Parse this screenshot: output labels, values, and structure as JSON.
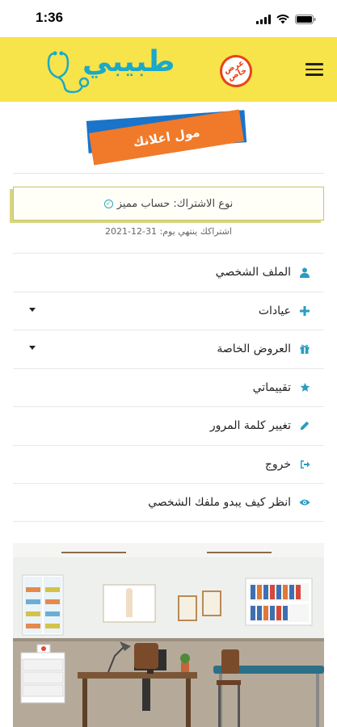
{
  "status_bar": {
    "time": "1:36"
  },
  "header": {
    "logo_text": "طبيبي",
    "offer_badge": "عرض خاص"
  },
  "ad_banner": {
    "label": "مول اعلانك"
  },
  "subscription": {
    "type_label": "نوع الاشتراك: حساب مميز",
    "expiry_text": "اشتراكك ينتهي يوم: 31-12-2021"
  },
  "menu": {
    "items": [
      {
        "label": "الملف الشخصي",
        "icon": "user-icon"
      },
      {
        "label": "عيادات",
        "icon": "plus-icon"
      },
      {
        "label": "العروض الخاصة",
        "icon": "gift-icon"
      },
      {
        "label": "تقييماتي",
        "icon": "star-icon"
      },
      {
        "label": "تغيير كلمة المرور",
        "icon": "pencil-icon"
      },
      {
        "label": "خروج",
        "icon": "logout-icon"
      },
      {
        "label": "انظر كيف يبدو ملفك الشخصي",
        "icon": "eye-icon"
      }
    ]
  },
  "colors": {
    "header_bg": "#f7e34a",
    "accent": "#2a9cc1",
    "ad_orange": "#f07a2a",
    "ad_blue": "#1a74c9"
  }
}
